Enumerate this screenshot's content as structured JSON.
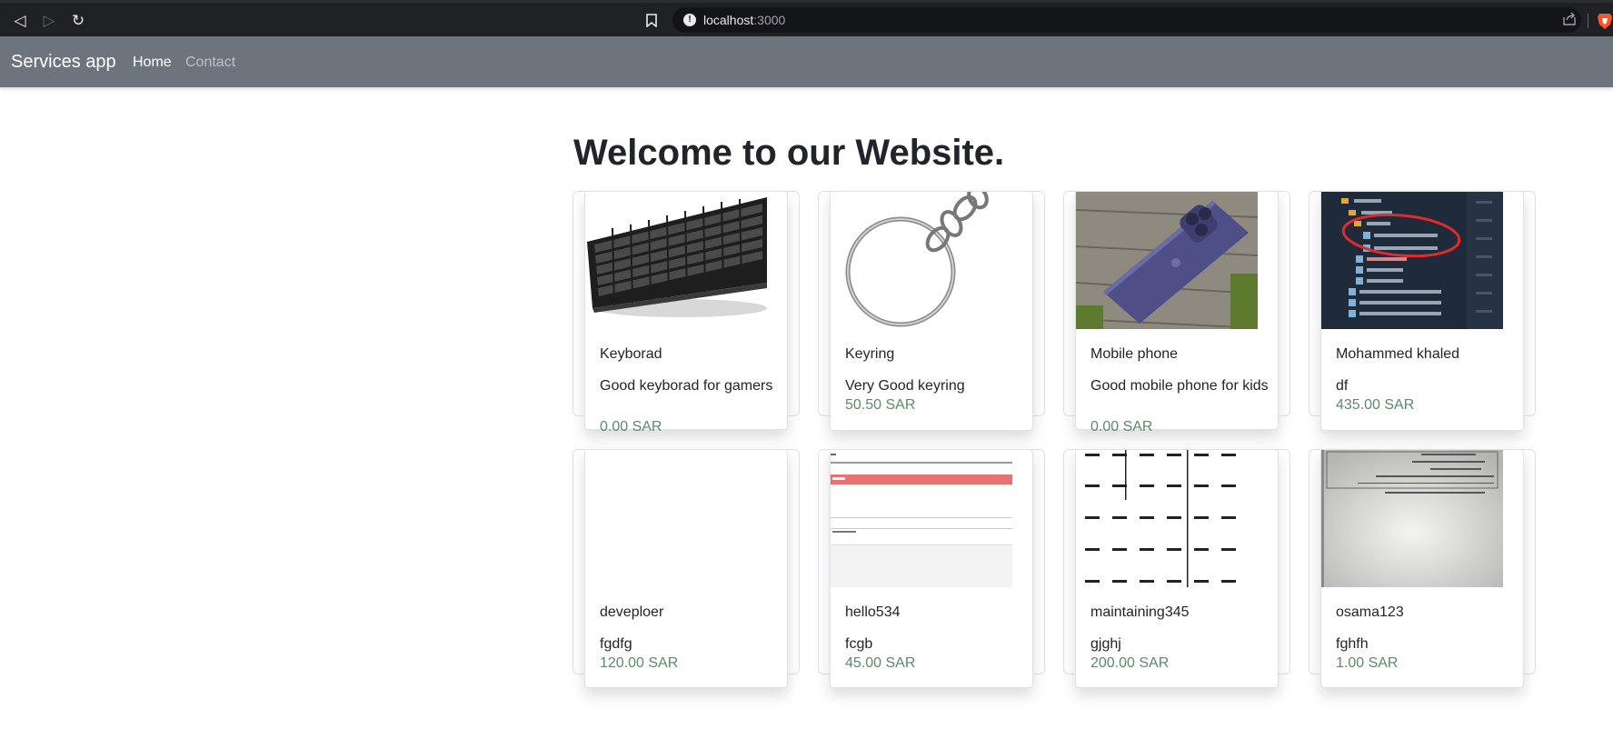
{
  "browser": {
    "url_host": "localhost",
    "url_port": ":3000"
  },
  "navbar": {
    "brand": "Services app",
    "links": [
      "Home",
      "Contact"
    ]
  },
  "main": {
    "heading": "Welcome to our Website."
  },
  "products": [
    {
      "name": "Keyborad",
      "description": "Good keyborad for gamers",
      "price": "0.00 SAR",
      "image": "keyboard"
    },
    {
      "name": "Keyring",
      "description": "Very Good keyring",
      "price": "50.50 SAR",
      "image": "keyring"
    },
    {
      "name": "Mobile phone",
      "description": "Good mobile phone for kids",
      "price": "0.00 SAR",
      "image": "phone"
    },
    {
      "name": "Mohammed khaled",
      "description": "df",
      "price": "435.00 SAR",
      "image": "file-tree-screenshot"
    },
    {
      "name": "deveploer",
      "description": "fgdfg",
      "price": "120.00 SAR",
      "image": "blank"
    },
    {
      "name": "hello534",
      "description": "fcgb",
      "price": "45.00 SAR",
      "image": "form-screenshot"
    },
    {
      "name": "maintaining345",
      "description": "gjghj",
      "price": "200.00 SAR",
      "image": "pattern"
    },
    {
      "name": "osama123",
      "description": "fghfh",
      "price": "1.00 SAR",
      "image": "document-scan"
    }
  ]
}
